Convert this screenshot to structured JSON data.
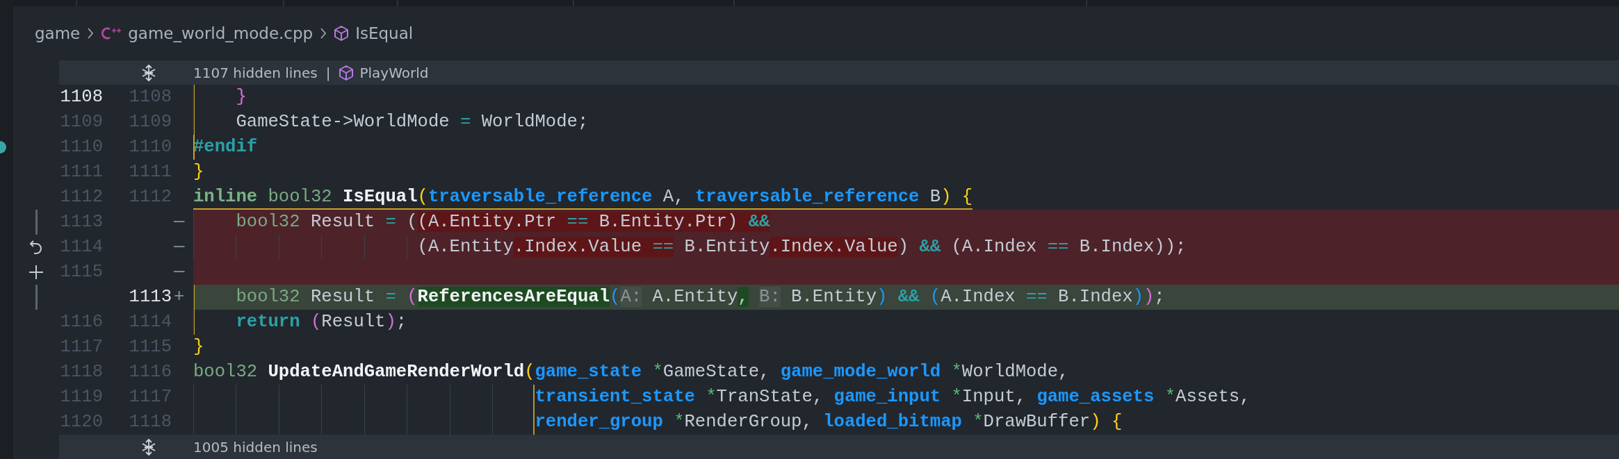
{
  "breadcrumb": [
    {
      "label": "game",
      "kind": "folder"
    },
    {
      "label": "game_world_mode.cpp",
      "kind": "cpp"
    },
    {
      "label": "IsEqual",
      "kind": "symbol"
    }
  ],
  "fold_top": {
    "text": "1107 hidden lines",
    "separator": "|",
    "symbol": "PlayWorld"
  },
  "rows": [
    {
      "old": "1108",
      "new": "1108",
      "kind": "context",
      "current": true,
      "dot": false,
      "underline": false,
      "scope_guide": true,
      "bracket_guide": false,
      "tokens": [
        {
          "text": "    }",
          "kind": "br2"
        }
      ]
    },
    {
      "old": "1109",
      "new": "1109",
      "kind": "context",
      "current": false,
      "dot": false,
      "underline": false,
      "scope_guide": true,
      "bracket_guide": false,
      "tokens": [
        {
          "text": "    GameState->WorldMode ",
          "kind": "p"
        },
        {
          "text": "=",
          "kind": "op"
        },
        {
          "text": " WorldMode;",
          "kind": "p"
        }
      ]
    },
    {
      "old": "1110",
      "new": "1110",
      "kind": "context",
      "current": false,
      "dot": true,
      "underline": false,
      "scope_guide": true,
      "bracket_guide": false,
      "tokens": [
        {
          "text": "#endif",
          "kind": "pp"
        }
      ]
    },
    {
      "old": "1111",
      "new": "1111",
      "kind": "context",
      "current": false,
      "dot": false,
      "underline": false,
      "scope_guide": false,
      "bracket_guide": false,
      "tokens": [
        {
          "text": "}",
          "kind": "br1"
        }
      ]
    },
    {
      "old": "1112",
      "new": "1112",
      "kind": "context",
      "current": false,
      "dot": false,
      "underline": true,
      "scope_guide": false,
      "bracket_guide": false,
      "tokens": [
        {
          "text": "inline",
          "kind": "kw"
        },
        {
          "text": " bool32",
          "kind": "ty"
        },
        {
          "text": " IsEqual",
          "kind": "fn"
        },
        {
          "text": "(",
          "kind": "br1"
        },
        {
          "text": "traversable_reference",
          "kind": "pt"
        },
        {
          "text": " A, ",
          "kind": "p"
        },
        {
          "text": "traversable_reference",
          "kind": "pt"
        },
        {
          "text": " B",
          "kind": "p"
        },
        {
          "text": ")",
          "kind": "br1"
        },
        {
          "text": " {",
          "kind": "br1"
        }
      ]
    },
    {
      "old": "1113",
      "marker": "—",
      "kind": "removed",
      "current": false,
      "dot": false,
      "underline": false,
      "scope_guide": false,
      "bracket_guide": false,
      "tokens": [
        {
          "text": "    bool32",
          "kind": "ty",
          "hl": false
        },
        {
          "text": " Result ",
          "kind": "p",
          "hl": false
        },
        {
          "text": "=",
          "kind": "op",
          "hl": false
        },
        {
          "text": " (",
          "kind": "p",
          "hl": false
        },
        {
          "text": "(A.Entity.Ptr ",
          "kind": "p",
          "hl": true
        },
        {
          "text": "==",
          "kind": "op",
          "hl": true
        },
        {
          "text": " B.Entity.Ptr) ",
          "kind": "p",
          "hl": true
        },
        {
          "text": "&&",
          "kind": "opb",
          "hl": true
        }
      ]
    },
    {
      "old": "1114",
      "marker": "—",
      "kind": "removed",
      "current": false,
      "dot": false,
      "underline": false,
      "scope_guide": false,
      "bracket_guide": false,
      "tokens": [
        {
          "text": "                     (A.Entity",
          "kind": "p",
          "hl": false
        },
        {
          "text": ".Index.Value ",
          "kind": "p",
          "hl": true
        },
        {
          "text": "==",
          "kind": "op",
          "hl": true
        },
        {
          "text": " B.Entity",
          "kind": "p",
          "hl": false
        },
        {
          "text": ".Index.Value",
          "kind": "p",
          "hl": true
        },
        {
          "text": ") ",
          "kind": "p",
          "hl": false
        },
        {
          "text": "&&",
          "kind": "opb",
          "hl": false
        },
        {
          "text": " (A.Index ",
          "kind": "p",
          "hl": false
        },
        {
          "text": "==",
          "kind": "op",
          "hl": false
        },
        {
          "text": " B.Index));",
          "kind": "p",
          "hl": false
        }
      ]
    },
    {
      "old": "1115",
      "marker": "—",
      "kind": "removed",
      "current": false,
      "dot": false,
      "underline": false,
      "scope_guide": false,
      "bracket_guide": false
    },
    {
      "new": "1113",
      "marker": "+",
      "kind": "added",
      "current": false,
      "dot": false,
      "underline": false,
      "scope_guide": true,
      "bracket_guide": false,
      "tokens": [
        {
          "text": "    bool32",
          "kind": "ty",
          "hl": false
        },
        {
          "text": " Result ",
          "kind": "p",
          "hl": false
        },
        {
          "text": "=",
          "kind": "op",
          "hl": false
        },
        {
          "text": " (",
          "kind": "br2",
          "hl": false
        },
        {
          "text": "ReferencesAreEqual",
          "kind": "fn",
          "hl": true
        },
        {
          "text": "(",
          "kind": "br3",
          "hl": false
        },
        {
          "text": "A:",
          "kind": "hint",
          "hl": false
        },
        {
          "text": " A.Entity",
          "kind": "p",
          "hl": false
        },
        {
          "text": ",",
          "kind": "p",
          "hl": true
        },
        {
          "text": " B:",
          "kind": "hint",
          "hl": false
        },
        {
          "text": " B.Entity",
          "kind": "p",
          "hl": false
        },
        {
          "text": ")",
          "kind": "br3",
          "hl": false
        },
        {
          "text": " &&",
          "kind": "opb",
          "hl": false
        },
        {
          "text": " (",
          "kind": "br3",
          "hl": false
        },
        {
          "text": "A.Index ",
          "kind": "p",
          "hl": false
        },
        {
          "text": "==",
          "kind": "op",
          "hl": false
        },
        {
          "text": " B.Index",
          "kind": "p",
          "hl": false
        },
        {
          "text": ")",
          "kind": "br3",
          "hl": false
        },
        {
          "text": ")",
          "kind": "br2",
          "hl": false
        },
        {
          "text": ";",
          "kind": "p",
          "hl": false
        }
      ]
    },
    {
      "old": "1116",
      "new": "1114",
      "kind": "context",
      "current": false,
      "dot": false,
      "underline": false,
      "scope_guide": true,
      "bracket_guide": false,
      "tokens": [
        {
          "text": "    return",
          "kind": "ret"
        },
        {
          "text": " (",
          "kind": "br2"
        },
        {
          "text": "Result",
          "kind": "p"
        },
        {
          "text": ")",
          "kind": "br2"
        },
        {
          "text": ";",
          "kind": "p"
        }
      ]
    },
    {
      "old": "1117",
      "new": "1115",
      "kind": "context",
      "current": false,
      "dot": false,
      "underline": false,
      "scope_guide": false,
      "bracket_guide": false,
      "tokens": [
        {
          "text": "}",
          "kind": "br1"
        }
      ]
    },
    {
      "old": "1118",
      "new": "1116",
      "kind": "context",
      "current": false,
      "dot": false,
      "underline": false,
      "scope_guide": false,
      "bracket_guide": false,
      "tokens": [
        {
          "text": "bool32",
          "kind": "ty"
        },
        {
          "text": " UpdateAndGameRenderWorld",
          "kind": "fn"
        },
        {
          "text": "(",
          "kind": "br1"
        },
        {
          "text": "game_state",
          "kind": "pt"
        },
        {
          "text": " *",
          "kind": "star"
        },
        {
          "text": "GameState, ",
          "kind": "p"
        },
        {
          "text": "game_mode_world",
          "kind": "pt"
        },
        {
          "text": " *",
          "kind": "star"
        },
        {
          "text": "WorldMode,",
          "kind": "p"
        }
      ]
    },
    {
      "old": "1119",
      "new": "1117",
      "kind": "context",
      "current": false,
      "dot": false,
      "underline": false,
      "scope_guide": false,
      "bracket_guide": true,
      "tokens": [
        {
          "text": "                                transient_state",
          "kind": "pt"
        },
        {
          "text": " *",
          "kind": "star"
        },
        {
          "text": "TranState, ",
          "kind": "p"
        },
        {
          "text": "game_input",
          "kind": "pt"
        },
        {
          "text": " *",
          "kind": "star"
        },
        {
          "text": "Input, ",
          "kind": "p"
        },
        {
          "text": "game_assets",
          "kind": "pt"
        },
        {
          "text": " *",
          "kind": "star"
        },
        {
          "text": "Assets,",
          "kind": "p"
        }
      ]
    },
    {
      "old": "1120",
      "new": "1118",
      "kind": "context",
      "current": false,
      "dot": false,
      "underline": false,
      "scope_guide": false,
      "bracket_guide": true,
      "tokens": [
        {
          "text": "                                render_group",
          "kind": "pt"
        },
        {
          "text": " *",
          "kind": "star"
        },
        {
          "text": "RenderGroup, ",
          "kind": "p"
        },
        {
          "text": "loaded_bitmap",
          "kind": "pt"
        },
        {
          "text": " *",
          "kind": "star"
        },
        {
          "text": "DrawBuffer",
          "kind": "p"
        },
        {
          "text": ")",
          "kind": "br1"
        },
        {
          "text": " {",
          "kind": "br1"
        }
      ]
    }
  ],
  "fold_bottom": {
    "text": "1005 hidden lines"
  }
}
